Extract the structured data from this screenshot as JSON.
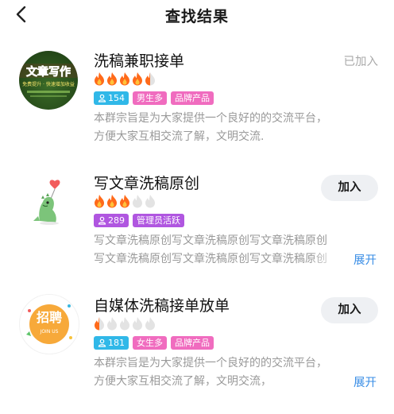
{
  "header": {
    "title": "查找结果"
  },
  "groups": [
    {
      "name": "洗稿兼职接单",
      "flames": {
        "full": 4,
        "half": 1,
        "empty": 0
      },
      "tags": [
        {
          "icon": "person-icon",
          "text": "154"
        },
        {
          "text": "男生多"
        },
        {
          "text": "品牌产品"
        }
      ],
      "desc_lines": [
        "本群宗旨是为大家提供一个良好的的交流平台，",
        "方便大家互相交流了解，文明交流."
      ],
      "status": "已加入",
      "avatar": {
        "top_text": "文章写作",
        "sub_text": "免费提升 · 快速增加收益"
      }
    },
    {
      "name": "写文章洗稿原创",
      "flames": {
        "full": 3,
        "half": 0,
        "empty": 2
      },
      "tags": [
        {
          "icon": "person-icon",
          "text": "289"
        },
        {
          "text": "管理员活跃"
        }
      ],
      "desc_lines": [
        "写文章洗稿原创写文章洗稿原创写文章洗稿原创",
        "写文章洗稿原创写文章洗稿原创写文章洗稿原创"
      ],
      "button": "加入",
      "expand": "展开"
    },
    {
      "name": "自媒体洗稿接单放单",
      "flames": {
        "full": 0,
        "half": 1,
        "empty": 4
      },
      "tags": [
        {
          "icon": "person-icon",
          "text": "181"
        },
        {
          "text": "女生多"
        },
        {
          "text": "品牌产品"
        }
      ],
      "desc_lines": [
        "本群宗旨是为大家提供一个良好的的交流平台，",
        "方便大家互相交流了解，文明交流，"
      ],
      "button": "加入",
      "expand": "展开",
      "avatar": {
        "text": "招聘",
        "sub_text": "JOIN US"
      }
    }
  ],
  "colors": {
    "flame_full": "#ff6a1a",
    "flame_empty": "#e3e3e3",
    "link": "#3a8ee6"
  }
}
